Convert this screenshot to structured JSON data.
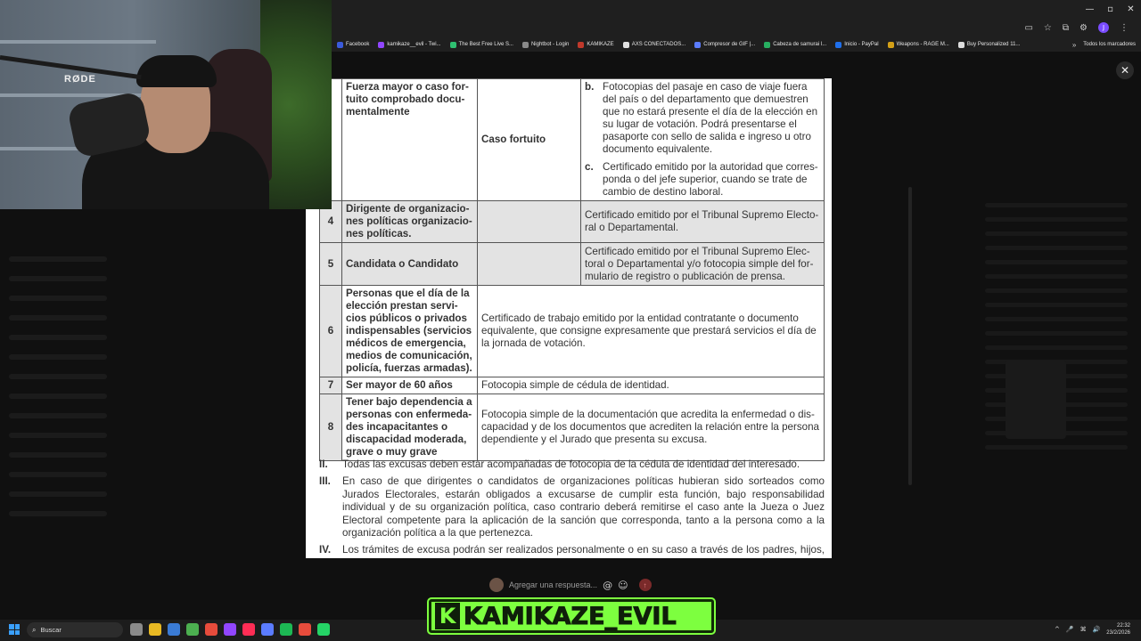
{
  "window_controls": [
    "—",
    "▫",
    "✕"
  ],
  "bookmarks": [
    {
      "label": "Facebook",
      "color": "#3b5bdb"
    },
    {
      "label": "kamikaze__evil - Twi...",
      "color": "#9146ff"
    },
    {
      "label": "The Best Free Live S...",
      "color": "#2fbf71"
    },
    {
      "label": "Nightbot - Login",
      "color": "#8a8a8a"
    },
    {
      "label": "KAMIKAZE",
      "color": "#c0392b"
    },
    {
      "label": "AXS CONECTADOS...",
      "color": "#e0e0e0"
    },
    {
      "label": "Compresor de GIF |...",
      "color": "#5b7cff"
    },
    {
      "label": "Cabeza de samurai l...",
      "color": "#27ae60"
    },
    {
      "label": "Inicio - PayPal",
      "color": "#1f6feb"
    },
    {
      "label": "Weapons - RAGE M...",
      "color": "#d4a017"
    },
    {
      "label": "Buy Personalized 11...",
      "color": "#dddddd"
    }
  ],
  "bookmarks_more": "»",
  "bookmarks_all": "Todos los marcadores",
  "close_icon_glyph": "✕",
  "table": {
    "rows": [
      {
        "num": "",
        "condition": "Fuerza mayor o caso for­tuito comprobado docu­mentalmente",
        "type": "Caso fortuito",
        "items": [
          {
            "letter": "b.",
            "text": "Fotocopias del pasaje en caso de viaje fuera del país o del departamento que demuestren que no estará presente el día de la elección en su lu­gar de votación. Podrá presentarse el pasaporte con sello de salida e ingreso u otro documento equivalente."
          },
          {
            "letter": "c.",
            "text": "Certificado emitido por la autoridad que corres­ponda o del jefe superior, cuando se trate de cambio de destino laboral."
          }
        ]
      },
      {
        "num": "4",
        "condition": "Dirigente de organizacio­nes políticas organizacio­nes políticas.",
        "type": "",
        "requirement": "Certificado emitido por el Tribunal Supremo Electo­ral o Departamental."
      },
      {
        "num": "5",
        "condition": "Candidata o Candidato",
        "type": "",
        "requirement": "Certificado emitido por el Tribunal Supremo Elec­toral o Departamental y/o fotocopia simple del for­mulario de registro o publicación de prensa."
      },
      {
        "num": "6",
        "condition": "Personas que el día de la elección prestan servi­cios públicos o privados indispensables (servicios médicos de emergencia, medios de comunicación, policía, fuerzas armadas).",
        "requirement": "Certificado de trabajo emitido por la entidad contratante o documento equivalente, que consigne expresamente que prestará servicios el día de la jornada de votación."
      },
      {
        "num": "7",
        "condition": "Ser mayor de 60 años",
        "requirement": "Fotocopia simple de cédula de identidad."
      },
      {
        "num": "8",
        "condition": "Tener bajo dependencia a personas con enfermeda­des incapacitantes o disca­pacidad moderada, grave o muy grave",
        "requirement": "Fotocopia simple de la documentación que acredita la  enfermedad o dis­capacidad y de los documentos que acrediten la relación entre la persona dependiente y el Jurado que presenta su excusa."
      }
    ]
  },
  "notes": [
    {
      "num": "II.",
      "text": "Todas las excusas deben estar acompañadas de fotocopia de la cédula de identidad del interesado."
    },
    {
      "num": "III.",
      "text": "En caso de que dirigentes o candidatos de organizaciones políticas hubieran sido sorteados como Jurados Elec­torales, estarán obligados a excusarse de cumplir esta función, bajo responsabilidad individual y de su organi­zación política, caso contrario deberá remitirse el caso ante la Jueza o Juez Electoral competente para la apli­cación de la sanción que corresponda, tanto a la persona como a la organización política a la que pertenezca."
    },
    {
      "num": "IV.",
      "text": "Los trámites de excusa podrán ser realizados personalmente o en su caso a través de los padres, hijos, hermanos, abuelos o esposos. Adicionalmente, se podrá realizar el trámite de excusa por vía digital en"
    }
  ],
  "reply": {
    "placeholder": "Agregar una respuesta...",
    "at_icon": "@",
    "emoji_icon": "☺",
    "send_icon": "↑"
  },
  "webcam": {
    "mic_brand": "RØDE"
  },
  "taskbar": {
    "search_label": "Buscar",
    "search_icon": "⌕",
    "apps": [
      "#8a8a8a",
      "#e8b923",
      "#3a7bd5",
      "#4caf50",
      "#e74c3c",
      "#9146ff",
      "#ff2d55",
      "#5b7cff",
      "#1db954",
      "#e74c3c",
      "#25d366"
    ],
    "tray_chevron": "^",
    "tray_icons": [
      "🎤",
      "⌘",
      "🔊"
    ],
    "time": "22:32",
    "date": "23/2/2026"
  },
  "overlay": {
    "badge": "K",
    "name": "KAMIKAZE_EVIL"
  }
}
